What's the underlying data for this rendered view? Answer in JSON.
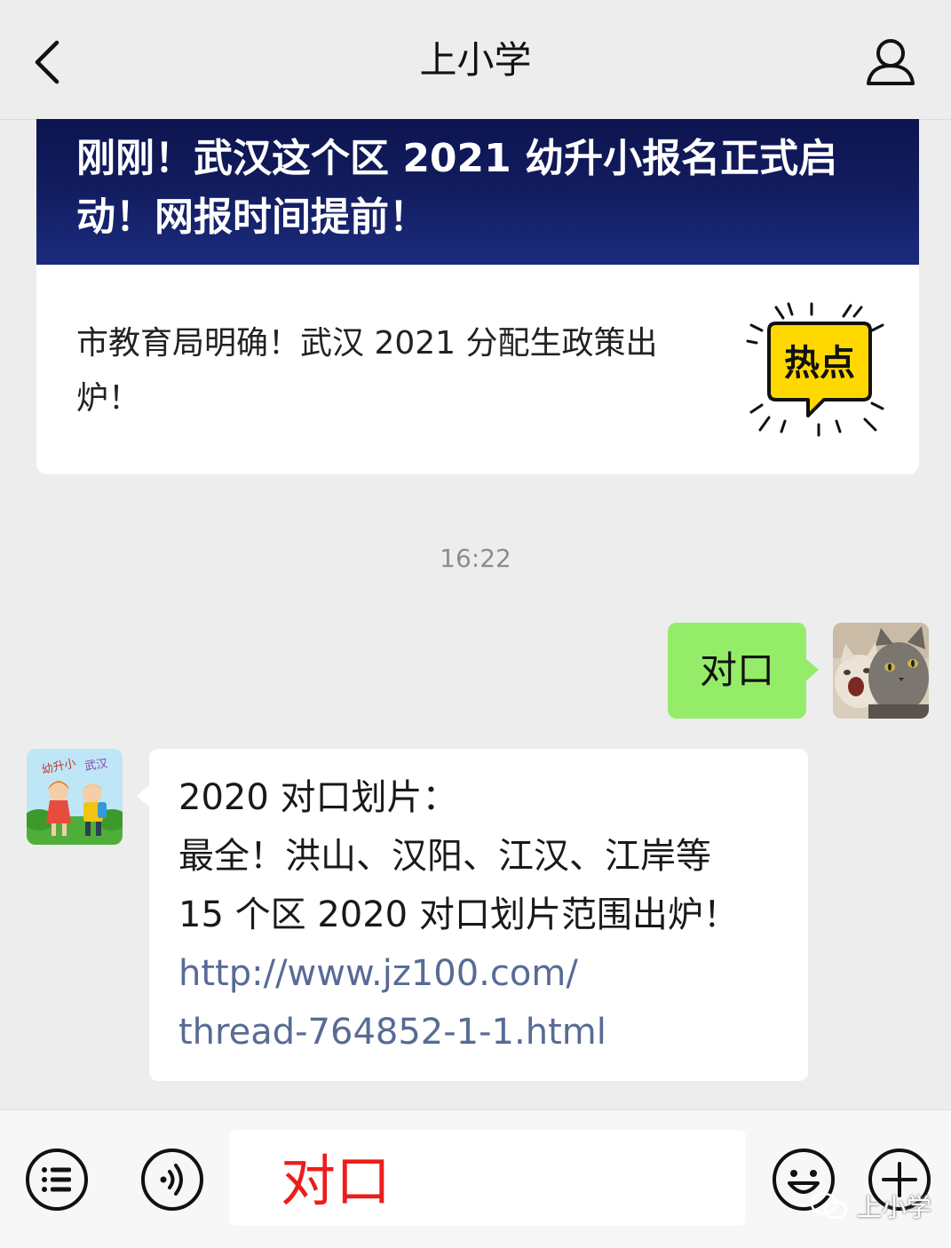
{
  "header": {
    "title": "上小学",
    "back_icon": "chevron-left-icon",
    "profile_icon": "person-icon"
  },
  "article": {
    "banner_title": "刚刚！武汉这个区 2021 幼升小报名正式启动！网报时间提前！",
    "sub_title": "市教育局明确！武汉 2021 分配生政策出炉！",
    "hot_label": "热点"
  },
  "timestamp": "16:22",
  "my_message": {
    "text": "对口"
  },
  "bot_message": {
    "line1": "2020 对口划片：",
    "line2": "最全！洪山、汉阳、江汉、江岸等",
    "line3": "15 个区 2020 对口划片范围出炉！",
    "link_part1": "http://www.jz100.com/",
    "link_part2": "thread-764852-1-1.html"
  },
  "input_bar": {
    "menu_icon": "list-menu-icon",
    "voice_icon": "voice-icon",
    "input_value": "对口",
    "emoji_icon": "emoji-icon",
    "add_icon": "plus-icon"
  },
  "watermark": {
    "text": "上小学"
  },
  "colors": {
    "background": "#ededed",
    "my_bubble": "#95ec69",
    "link": "#576b95",
    "banner": "#121c5e",
    "input_text": "#ee1c1c",
    "hot_yellow": "#ffd800"
  }
}
